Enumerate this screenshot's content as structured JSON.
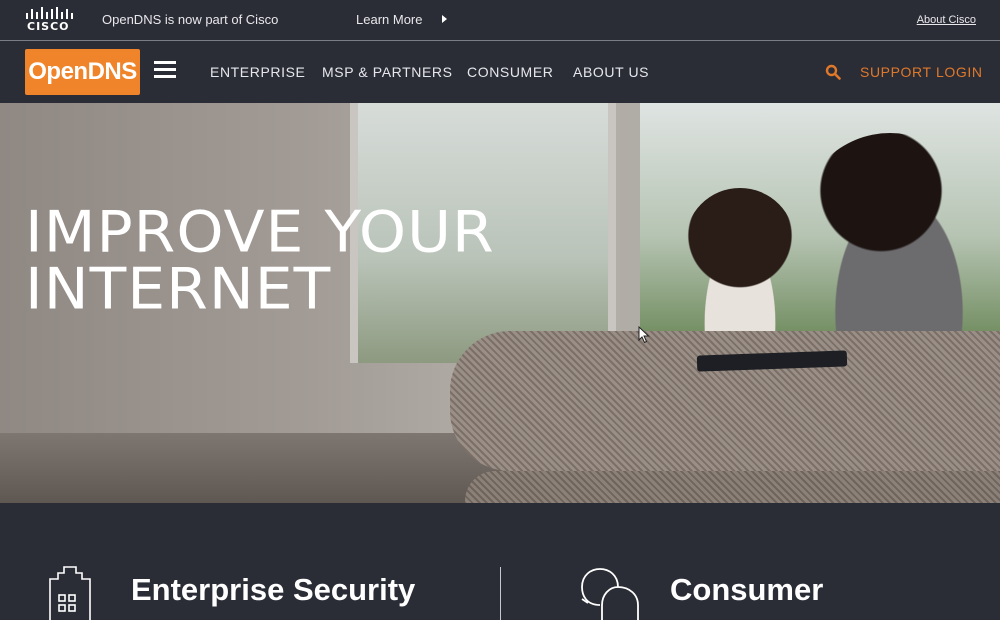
{
  "topbar": {
    "brand_word": "CISCO",
    "message": "OpenDNS is now part of Cisco",
    "learn_more": "Learn More",
    "about_link": "About Cisco"
  },
  "nav": {
    "brand": "OpenDNS",
    "items": [
      "ENTERPRISE",
      "MSP & PARTNERS",
      "CONSUMER",
      "ABOUT US"
    ],
    "support": "SUPPORT",
    "login": "LOGIN"
  },
  "hero": {
    "title_line1": "IMPROVE YOUR",
    "title_line2": "INTERNET"
  },
  "cards": {
    "enterprise_title": "Enterprise Security",
    "consumer_title": "Consumer"
  },
  "colors": {
    "accent": "#f0842a",
    "nav_link_accent": "#e0782a",
    "background": "#2b2d36"
  },
  "icons": {
    "topbar_logo": "cisco-logo-icon",
    "topbar_arrow": "triangle-right-icon",
    "menu": "hamburger-icon",
    "search": "search-icon",
    "enterprise": "building-icon",
    "consumer": "chat-bubbles-icon"
  }
}
